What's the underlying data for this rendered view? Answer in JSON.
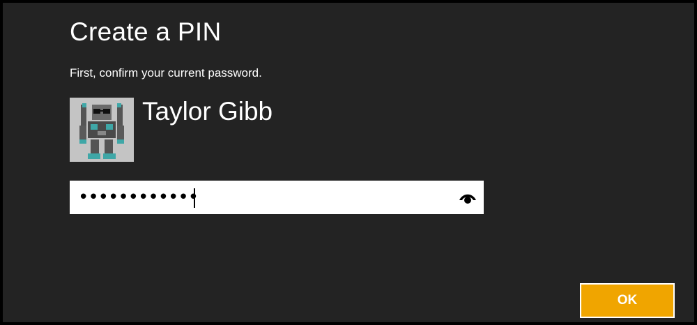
{
  "dialog": {
    "title": "Create a PIN",
    "subtitle": "First, confirm your current password."
  },
  "user": {
    "name": "Taylor Gibb",
    "avatar_icon": "robot-avatar-icon"
  },
  "password": {
    "masked_value": "••••••••••••",
    "reveal_icon": "eye-icon"
  },
  "buttons": {
    "ok_label": "OK"
  },
  "colors": {
    "background": "#232323",
    "accent": "#f0a500",
    "text": "#ffffff"
  }
}
